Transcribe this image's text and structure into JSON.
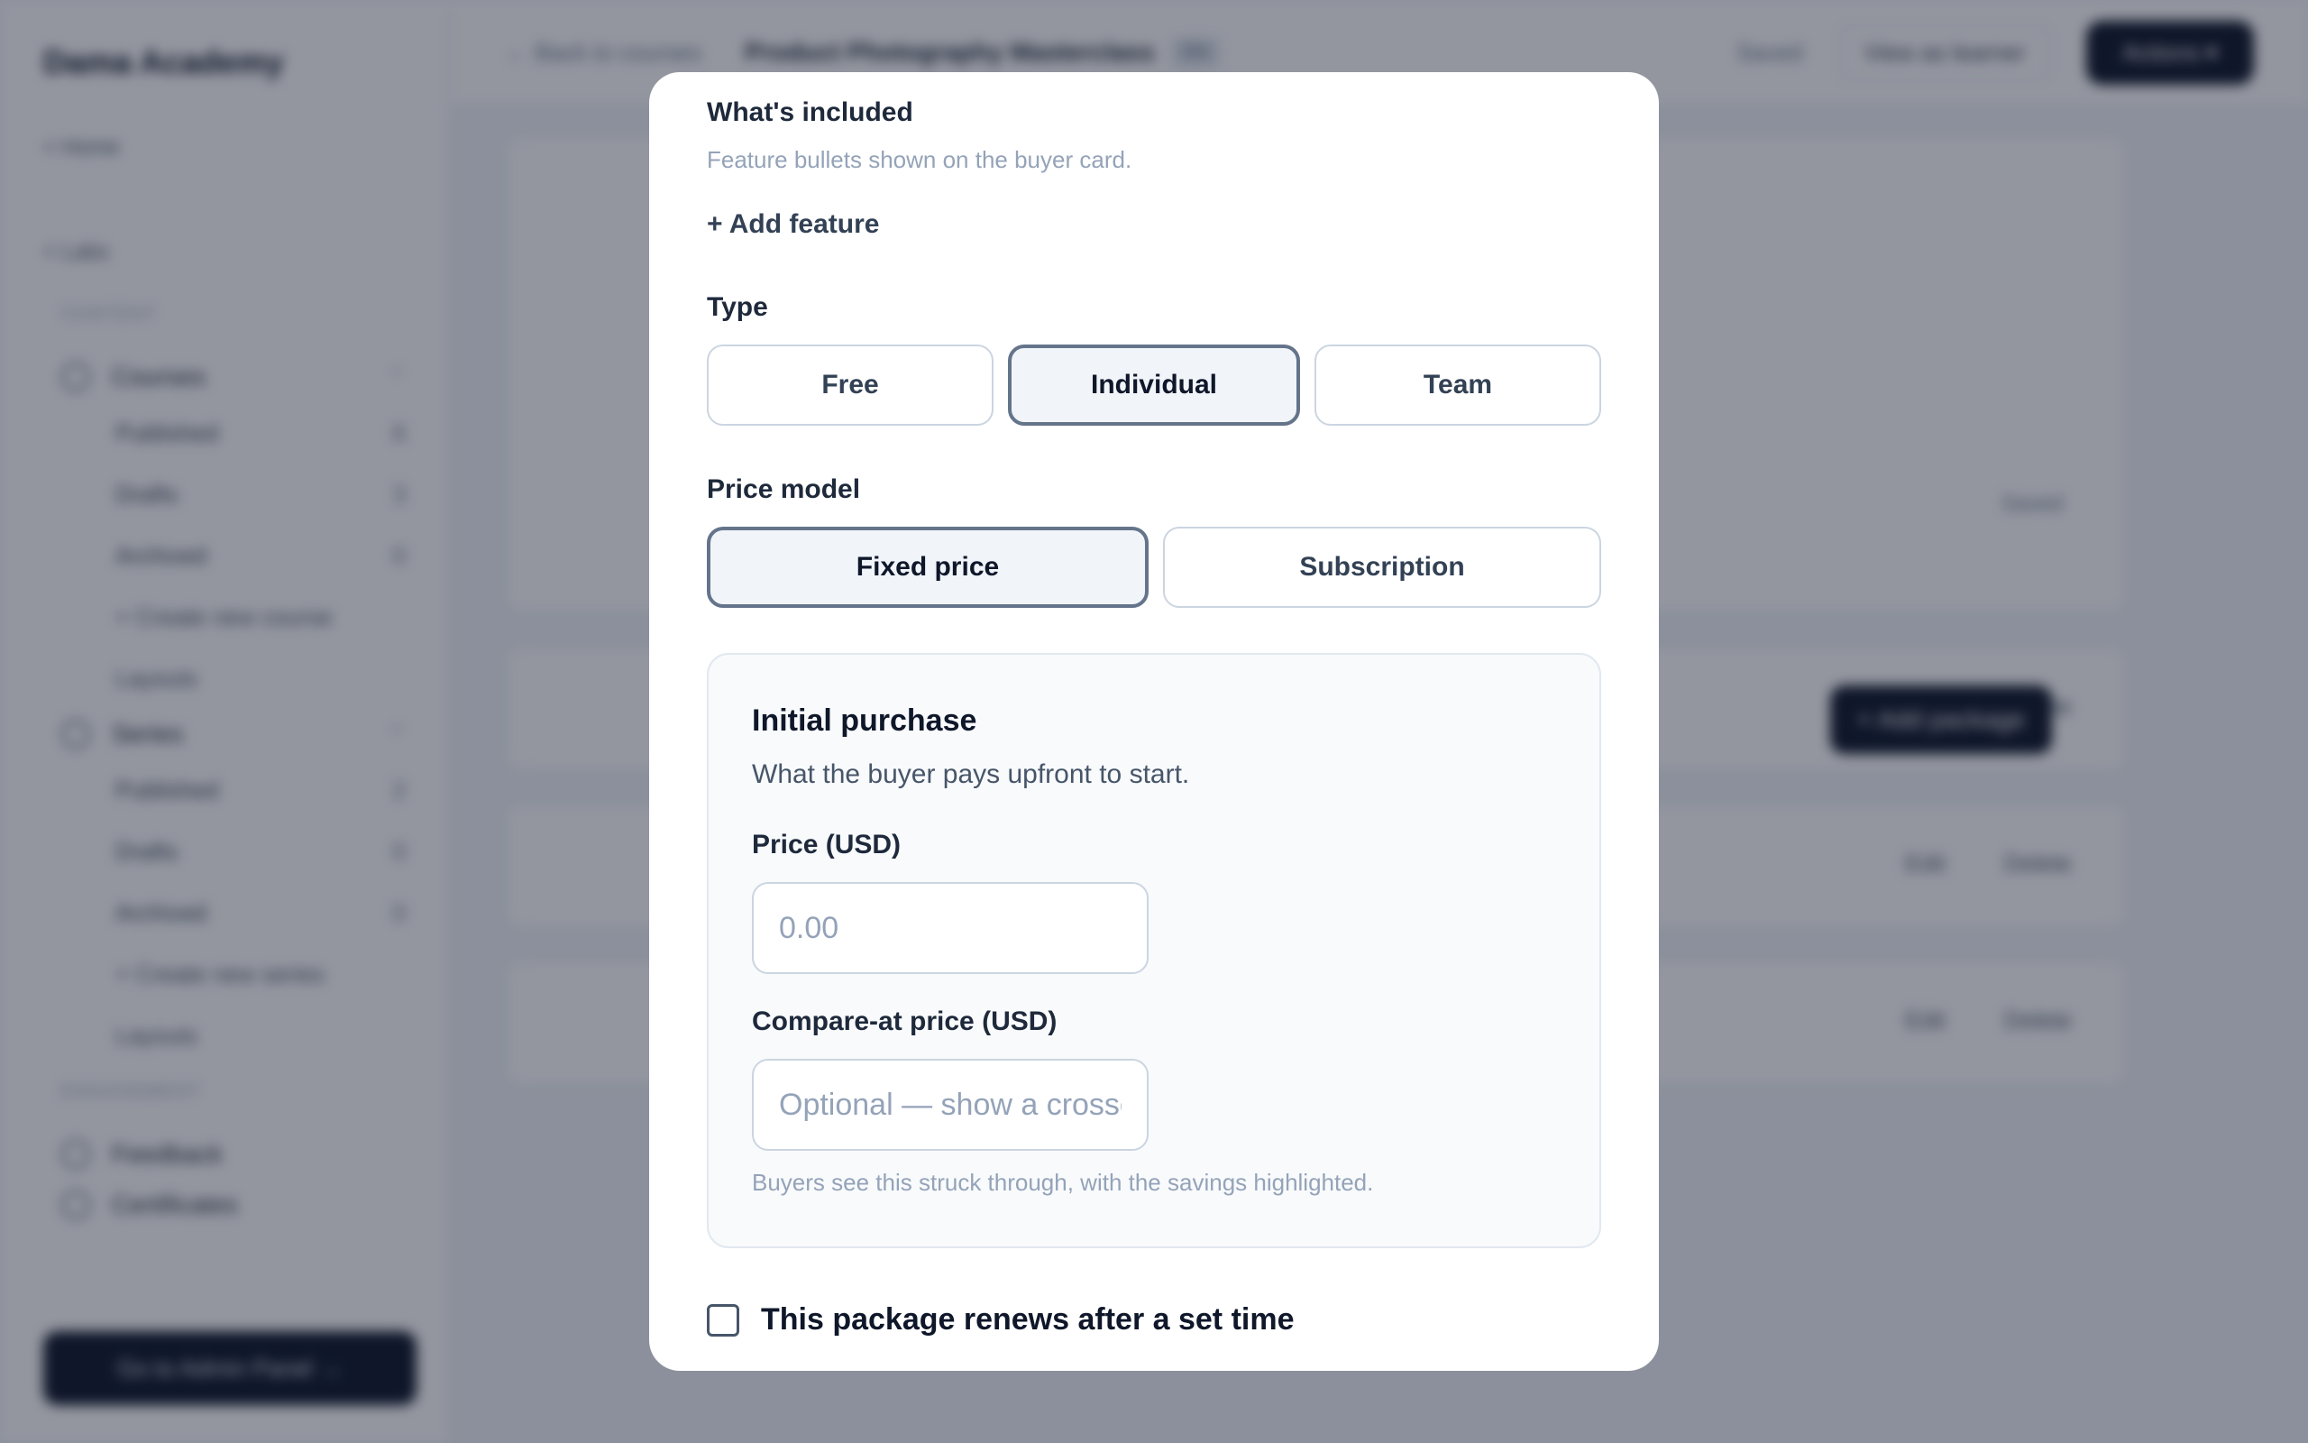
{
  "background": {
    "brand": "Dama Academy",
    "home_link": "< Home",
    "labs_link": "< Labs",
    "content_label": "CONTENT",
    "courses": {
      "label": "Courses",
      "items": [
        {
          "label": "Published",
          "count": "6"
        },
        {
          "label": "Drafts",
          "count": "3"
        },
        {
          "label": "Archived",
          "count": "0"
        }
      ],
      "create": "+ Create new course",
      "layouts": "Layouts"
    },
    "series": {
      "label": "Series",
      "items": [
        {
          "label": "Published",
          "count": "2"
        },
        {
          "label": "Drafts",
          "count": "0"
        },
        {
          "label": "Archived",
          "count": "0"
        }
      ],
      "create": "+ Create new series",
      "layouts": "Layouts"
    },
    "engagement_label": "ENGAGEMENT",
    "feedback": "Feedback",
    "certificates": "Certificates",
    "admin_button": "Go to Admin Panel →",
    "topbar": {
      "back": "← Back to courses",
      "course_title": "Product Photography Masterclass",
      "tag": "EN",
      "saved": "Saved",
      "view_as_learner": "View as learner",
      "actions": "Actions ▾"
    },
    "saved_inline": "Saved",
    "add_package": "+ Add package",
    "row_edit": "Edit",
    "row_delete": "Delete"
  },
  "modal": {
    "included": {
      "title": "What's included",
      "hint": "Feature bullets shown on the buyer card.",
      "add_feature": "+ Add feature"
    },
    "type": {
      "title": "Type",
      "options": [
        "Free",
        "Individual",
        "Team"
      ],
      "selected": "Individual"
    },
    "price_model": {
      "title": "Price model",
      "options": [
        "Fixed price",
        "Subscription"
      ],
      "selected": "Fixed price"
    },
    "initial_purchase": {
      "title": "Initial purchase",
      "subtitle": "What the buyer pays upfront to start.",
      "price_label": "Price (USD)",
      "price_placeholder": "0.00",
      "compare_label": "Compare-at price (USD)",
      "compare_placeholder": "Optional — show a crossed-out price",
      "compare_note": "Buyers see this struck through, with the savings highlighted."
    },
    "renews": {
      "label": "This package renews after a set time",
      "checked": false
    }
  }
}
